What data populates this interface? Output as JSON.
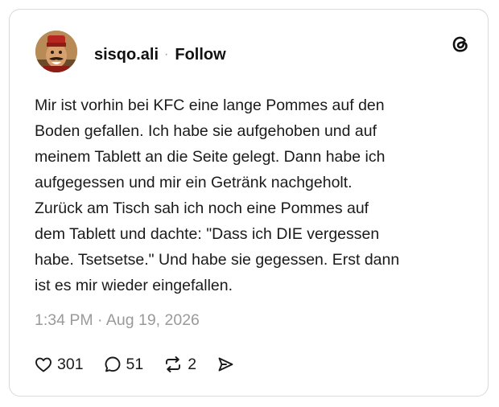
{
  "author": {
    "username": "sisqo.ali",
    "separator": "·",
    "follow_label": "Follow",
    "avatar_icon": "avatar-man-fez"
  },
  "app_logo_icon": "threads-logo-icon",
  "post": {
    "text": "Mir ist vorhin bei KFC eine lange Pommes auf den\nBoden gefallen. Ich habe sie aufgehoben und auf\nmeinem Tablett an die Seite gelegt. Dann habe ich\naufgegessen und mir ein Getränk nachgeholt.\nZurück am Tisch sah ich noch eine Pommes auf\ndem Tablett und dachte: \"Dass ich DIE vergessen\nhabe. Tsetsetse.\" Und habe sie gegessen. Erst dann\nist es mir wieder eingefallen.",
    "timestamp": "1:34 PM · Aug 19, 2026"
  },
  "actions": {
    "like_count": "301",
    "reply_count": "51",
    "repost_count": "2"
  },
  "colors": {
    "text": "#1a1a1a",
    "muted": "#9a9a9a",
    "border": "#d9d9d9"
  }
}
